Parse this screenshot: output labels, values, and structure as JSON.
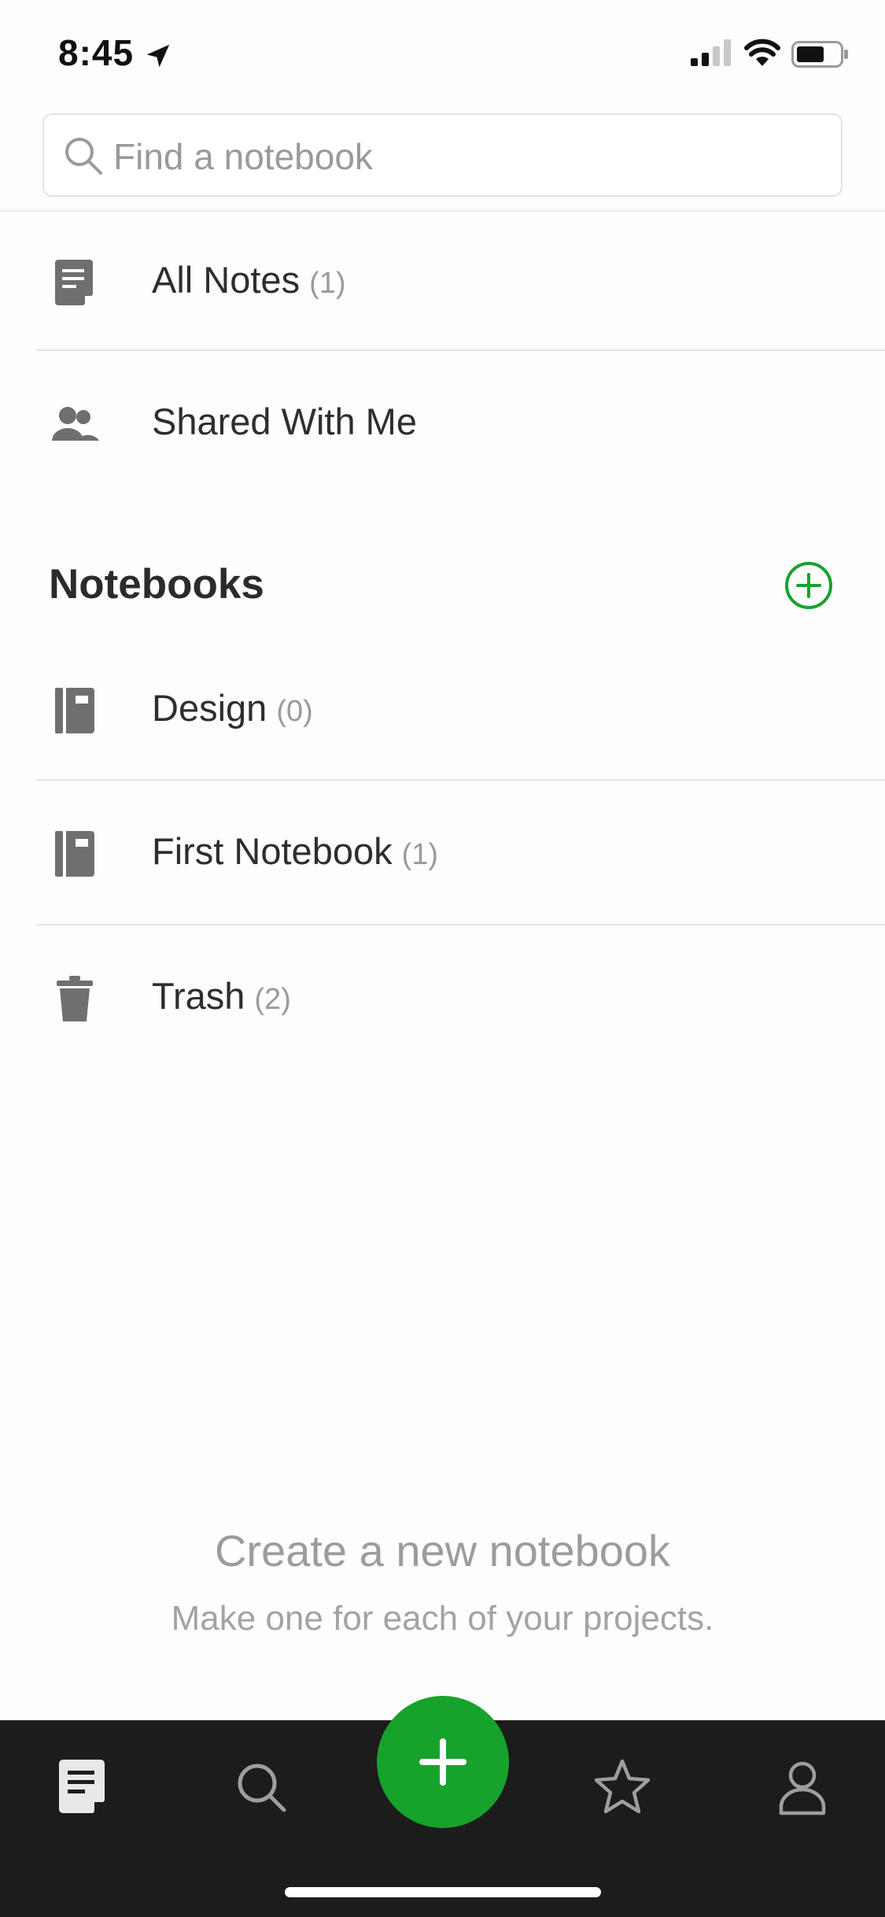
{
  "status_bar": {
    "time": "8:45",
    "icons": [
      "location-arrow-icon",
      "cellular-signal-icon",
      "wifi-icon",
      "battery-icon"
    ]
  },
  "search": {
    "placeholder": "Find a notebook",
    "icon": "search-icon"
  },
  "shortcuts": [
    {
      "label": "All Notes",
      "count": "(1)",
      "icon": "note-icon"
    },
    {
      "label": "Shared With Me",
      "count": "",
      "icon": "people-icon"
    }
  ],
  "notebooks_section": {
    "title": "Notebooks",
    "add_icon": "add-circle-icon",
    "accent_color": "#17a22c"
  },
  "notebooks": [
    {
      "label": "Design",
      "count": "(0)",
      "icon": "notebook-icon"
    },
    {
      "label": "First Notebook",
      "count": "(1)",
      "icon": "notebook-icon"
    },
    {
      "label": "Trash",
      "count": "(2)",
      "icon": "trash-icon"
    }
  ],
  "empty_state": {
    "title": "Create a new notebook",
    "subtitle": "Make one for each of your projects."
  },
  "tab_bar": {
    "tabs": [
      "notes-icon",
      "search-icon",
      "new-note-plus-icon",
      "star-icon",
      "account-icon"
    ],
    "active_tab": "notes-icon",
    "fab_color": "#17a22c",
    "background": "#1c1c1c"
  }
}
